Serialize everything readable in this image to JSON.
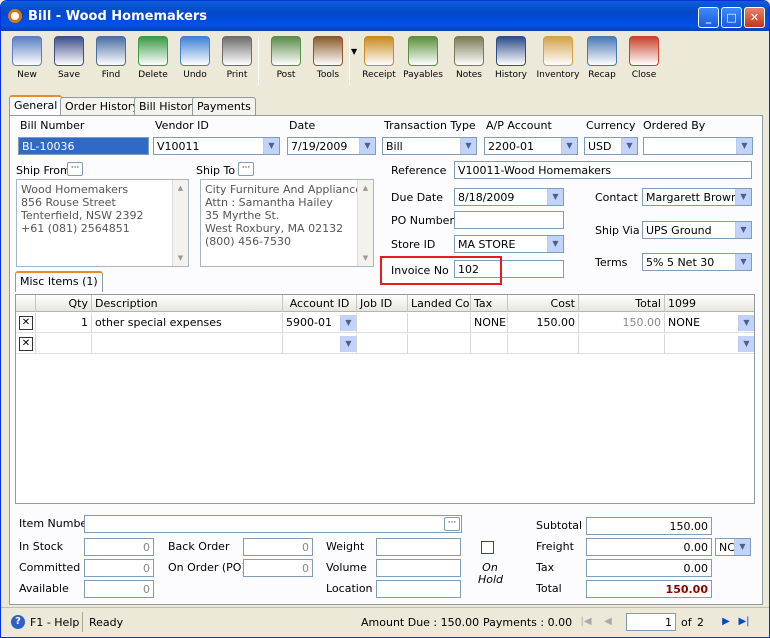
{
  "window": {
    "title": "Bill - Wood Homemakers"
  },
  "toolbar": [
    {
      "label": "New",
      "icon": "new-icon",
      "color": "#5a7fc2"
    },
    {
      "label": "Save",
      "icon": "save-icon",
      "color": "#3c4f8a"
    },
    {
      "label": "Find",
      "icon": "binoculars-icon",
      "color": "#4a6fa5"
    },
    {
      "label": "Delete",
      "icon": "recycle-bin-icon",
      "color": "#3a9a47"
    },
    {
      "label": "Undo",
      "icon": "undo-arrow-icon",
      "color": "#3d82d6"
    },
    {
      "label": "Print",
      "icon": "printer-icon",
      "color": "#6d6d6d"
    },
    {
      "label": "Post",
      "icon": "post-document-icon",
      "color": "#5c8c4a"
    },
    {
      "label": "Tools",
      "icon": "tools-icon",
      "color": "#8b5a2b"
    },
    {
      "label": "Receipt",
      "icon": "receipt-icon",
      "color": "#c98b1d"
    },
    {
      "label": "Payables",
      "icon": "payables-icon",
      "color": "#5b8f3a"
    },
    {
      "label": "Notes",
      "icon": "notes-icon",
      "color": "#7a7a55"
    },
    {
      "label": "History",
      "icon": "history-icon",
      "color": "#2d4e8a"
    },
    {
      "label": "Inventory",
      "icon": "inventory-boxes-icon",
      "color": "#d3a34a"
    },
    {
      "label": "Recap",
      "icon": "recap-icon",
      "color": "#4a78b5"
    },
    {
      "label": "Close",
      "icon": "close-window-icon",
      "color": "#c9422b"
    }
  ],
  "tabs": [
    "General",
    "Order History",
    "Bill History",
    "Payments"
  ],
  "header": {
    "bill_number_label": "Bill Number",
    "bill_number": "BL-10036",
    "vendor_id_label": "Vendor ID",
    "vendor_id": "V10011",
    "date_label": "Date",
    "date": "7/19/2009",
    "transaction_type_label": "Transaction Type",
    "transaction_type": "Bill",
    "ap_account_label": "A/P Account",
    "ap_account": "2200-01",
    "currency_label": "Currency",
    "currency": "USD",
    "ordered_by_label": "Ordered By",
    "ordered_by": ""
  },
  "ship_from": {
    "label": "Ship From",
    "address": "Wood Homemakers\n856 Rouse Street\nTenterfield, NSW 2392\n+61 (081) 2564851"
  },
  "ship_to": {
    "label": "Ship To",
    "address": "City Furniture And Appliance\nAttn : Samantha Hailey\n35 Myrthe St.\nWest Roxbury, MA 02132\n(800) 456-7530"
  },
  "details": {
    "reference_label": "Reference",
    "reference": "V10011-Wood Homemakers",
    "due_date_label": "Due Date",
    "due_date": "8/18/2009",
    "po_number_label": "PO Number",
    "po_number": "",
    "store_id_label": "Store ID",
    "store_id": "MA STORE",
    "invoice_no_label": "Invoice No",
    "invoice_no": "102",
    "contact_label": "Contact",
    "contact": "Margarett Brown",
    "ship_via_label": "Ship Via",
    "ship_via": "UPS Ground",
    "terms_label": "Terms",
    "terms": "5% 5 Net 30"
  },
  "subtab": "Misc Items (1)",
  "grid": {
    "columns": [
      "Qty",
      "Description",
      "Account ID",
      "Job ID",
      "Landed Cos",
      "Tax",
      "Cost",
      "Total",
      "1099"
    ],
    "rows": [
      {
        "qty": "1",
        "description": "other special expenses",
        "account_id": "5900-01",
        "job_id": "",
        "landed": "",
        "tax": "NONE",
        "cost": "150.00",
        "total": "150.00",
        "f1099": "NONE"
      },
      {
        "qty": "",
        "description": "",
        "account_id": "",
        "job_id": "",
        "landed": "",
        "tax": "",
        "cost": "",
        "total": "",
        "f1099": ""
      }
    ]
  },
  "footer": {
    "item_number_label": "Item Number",
    "item_number": "",
    "in_stock_label": "In Stock",
    "in_stock": "0",
    "committed_label": "Committed",
    "committed": "0",
    "available_label": "Available",
    "available": "0",
    "back_order_label": "Back Order",
    "back_order": "0",
    "on_order_label": "On Order (PO)",
    "on_order": "0",
    "weight_label": "Weight",
    "weight": "",
    "volume_label": "Volume",
    "volume": "",
    "location_label": "Location",
    "location": "",
    "on_hold_label": "On Hold",
    "subtotal_label": "Subtotal",
    "subtotal": "150.00",
    "freight_label": "Freight",
    "freight": "0.00",
    "freight_code": "NC",
    "tax_label": "Tax",
    "tax": "0.00",
    "total_label": "Total",
    "total": "150.00"
  },
  "status": {
    "help": "F1 - Help",
    "state": "Ready",
    "amount_due": "Amount Due : 150.00",
    "payments": "Payments : 0.00",
    "page": "1",
    "of": "of",
    "pages": "2"
  }
}
